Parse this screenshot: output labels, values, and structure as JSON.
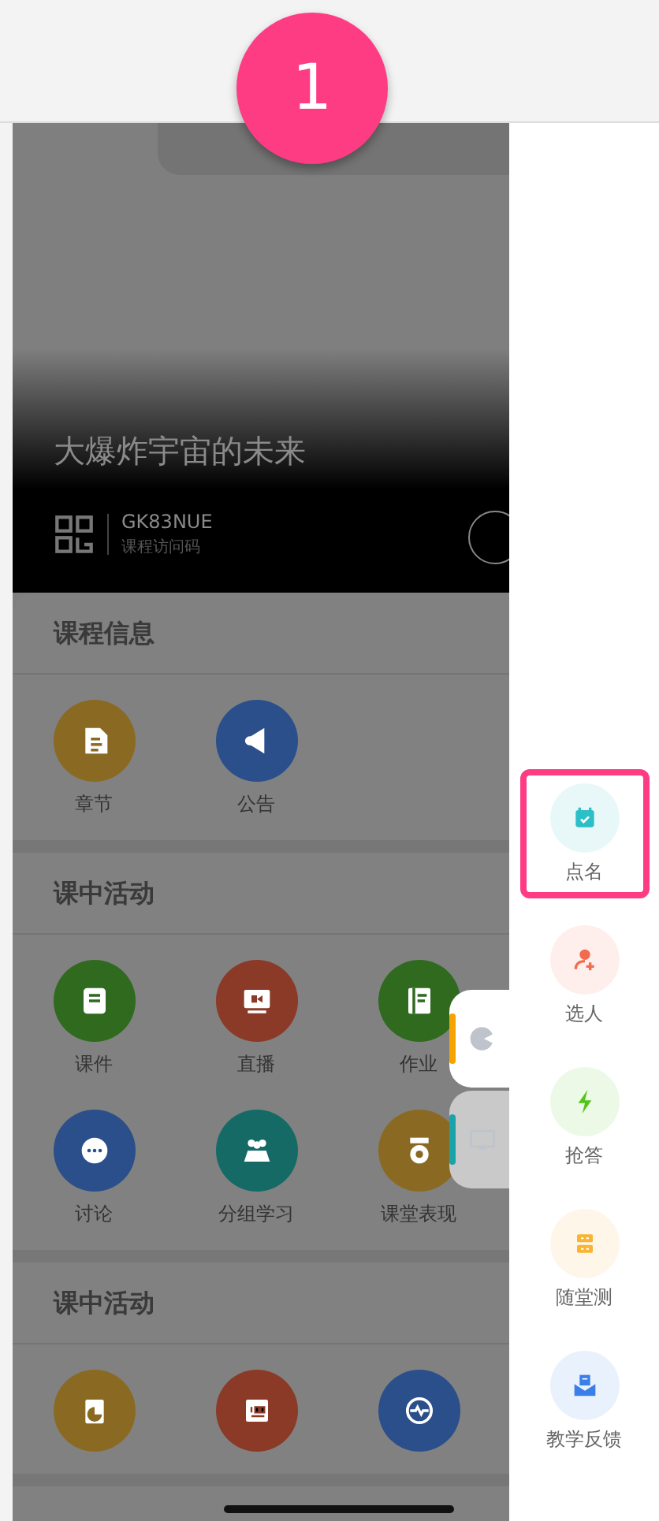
{
  "step_badge": "1",
  "course": {
    "title": "大爆炸宇宙的未来",
    "access_code": "GK83NUE",
    "access_code_label": "课程访问码"
  },
  "sections": [
    {
      "title": "课程信息",
      "items": [
        {
          "label": "章节",
          "kind": "document",
          "color": "#8a6a22"
        },
        {
          "label": "公告",
          "kind": "megaphone",
          "color": "#2a4f8a"
        }
      ]
    },
    {
      "title": "课中活动",
      "items": [
        {
          "label": "课件",
          "kind": "slides",
          "color": "#2f6a1e"
        },
        {
          "label": "直播",
          "kind": "video",
          "color": "#8a3a26"
        },
        {
          "label": "作业",
          "kind": "notebook",
          "color": "#2f6a1e"
        },
        {
          "label": "讨论",
          "kind": "chat",
          "color": "#2a4f8a"
        },
        {
          "label": "分组学习",
          "kind": "group",
          "color": "#156a66"
        },
        {
          "label": "课堂表现",
          "kind": "medal",
          "color": "#8a6a22"
        }
      ]
    },
    {
      "title": "课中活动",
      "items": [
        {
          "kind": "clipboard",
          "color": "#8a6a22"
        },
        {
          "kind": "score",
          "color": "#8a3a26"
        },
        {
          "kind": "pulse",
          "color": "#2a4f8a"
        }
      ]
    }
  ],
  "side_tabs": [
    {
      "kind": "game",
      "color": "#f5a300"
    },
    {
      "kind": "screen",
      "color": "#1aa3a8"
    }
  ],
  "tools": [
    {
      "label": "点名",
      "kind": "calendar-check",
      "color": "#2cbfc8",
      "selected": true
    },
    {
      "label": "选人",
      "kind": "person-add",
      "color": "#f26b4f",
      "selected": false
    },
    {
      "label": "抢答",
      "kind": "bolt",
      "color": "#52c41a",
      "selected": false
    },
    {
      "label": "随堂测",
      "kind": "quiz",
      "color": "#f8b435",
      "selected": false
    },
    {
      "label": "教学反馈",
      "kind": "mail",
      "color": "#3a7ee8",
      "selected": false
    }
  ]
}
